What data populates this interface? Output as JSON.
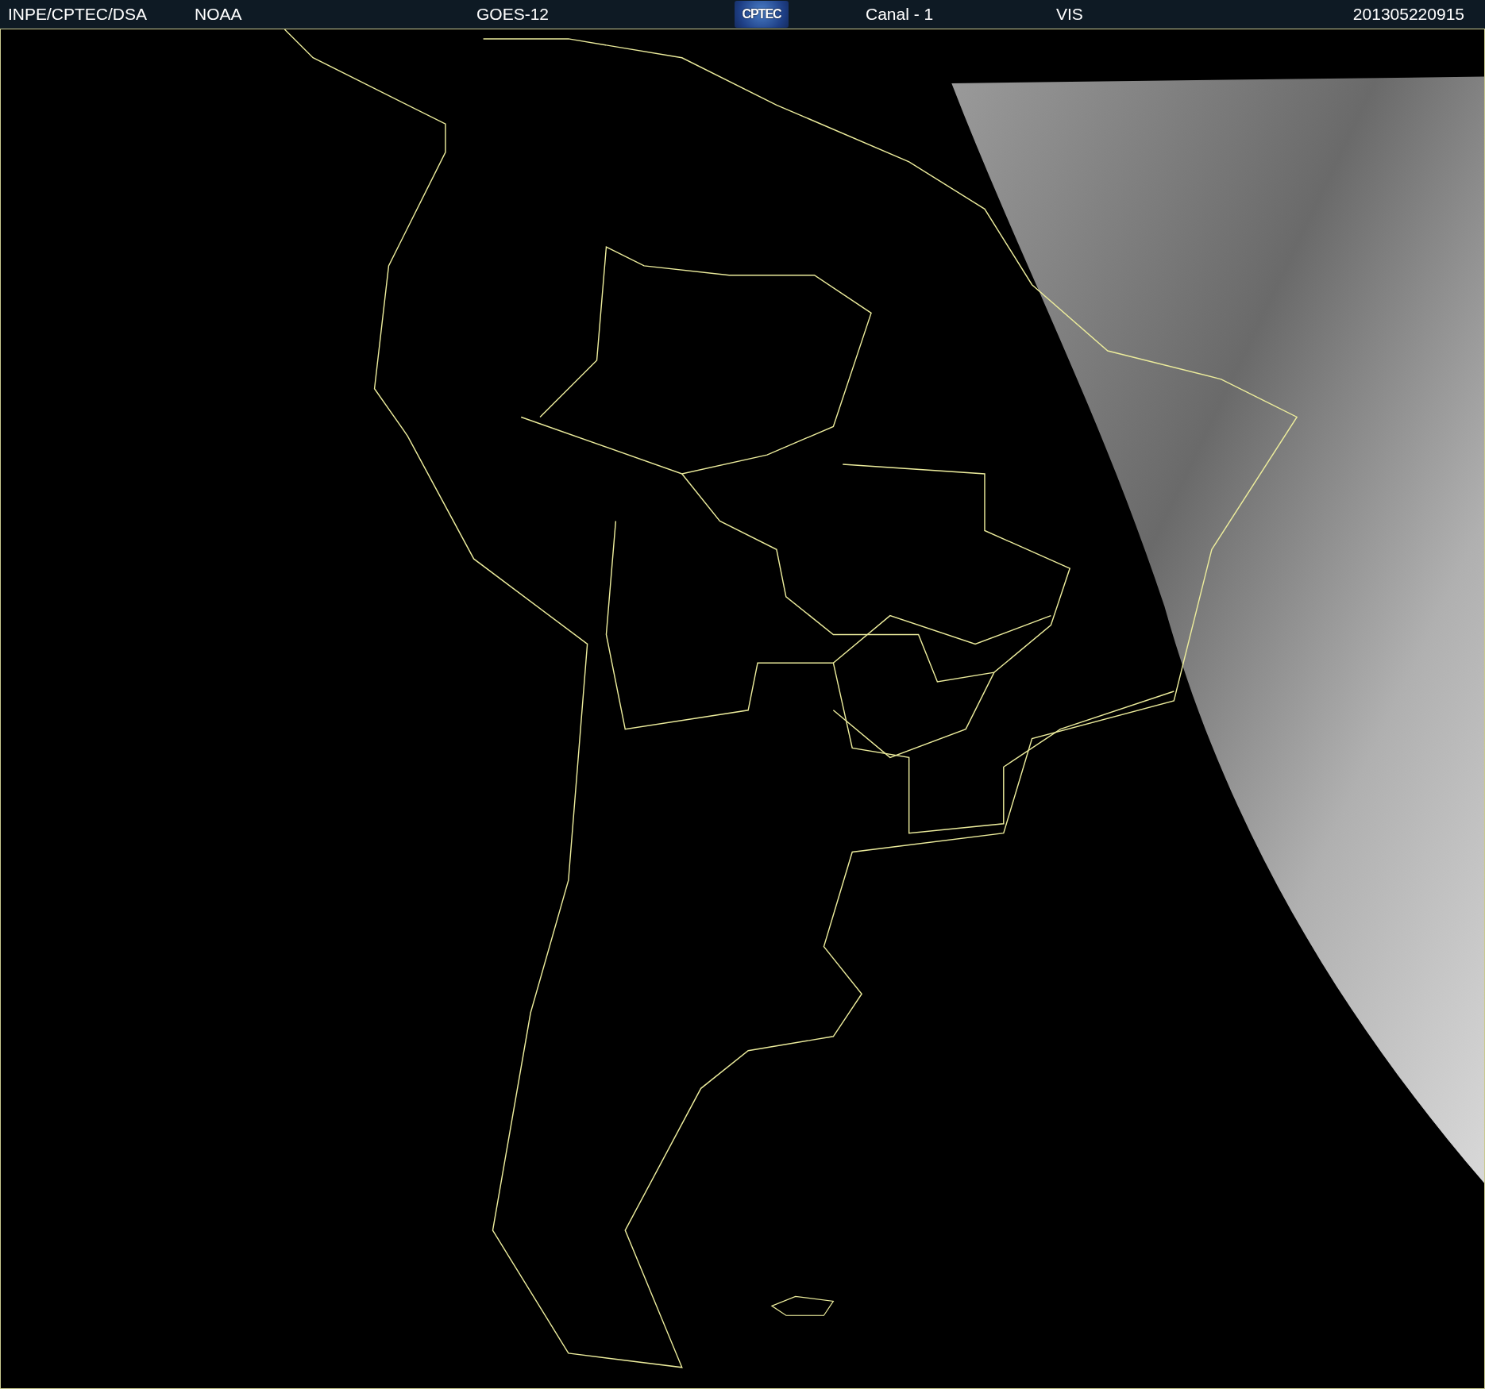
{
  "header": {
    "items": [
      {
        "kind": "text",
        "text": "INPE/CPTEC/DSA"
      },
      {
        "kind": "text",
        "text": "NOAA"
      },
      {
        "kind": "text",
        "text": "GOES-12"
      },
      {
        "kind": "logo",
        "text": "CPTEC"
      },
      {
        "kind": "text",
        "text": "Canal - 1"
      },
      {
        "kind": "text",
        "text": "VIS"
      },
      {
        "kind": "text",
        "text": "201305220915"
      }
    ]
  }
}
